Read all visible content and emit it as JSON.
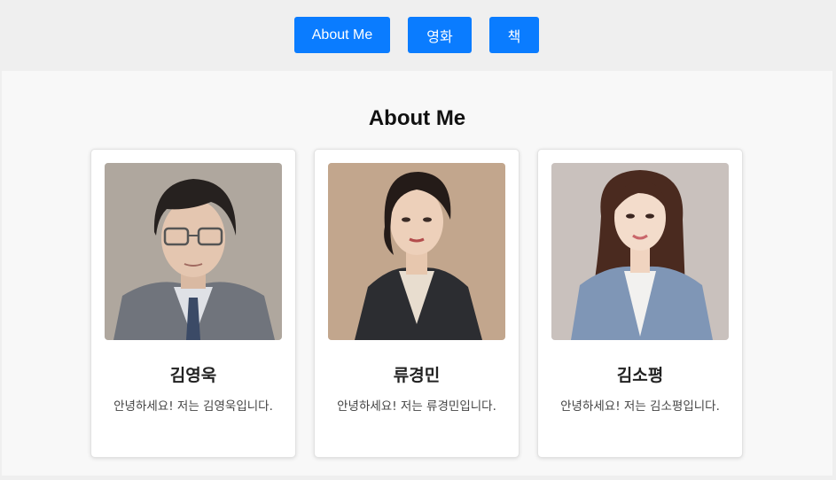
{
  "nav": {
    "about_label": "About Me",
    "movies_label": "영화",
    "books_label": "책",
    "accent_color": "#0a7cff"
  },
  "section": {
    "title": "About Me"
  },
  "profiles": [
    {
      "name": "김영욱",
      "description": "안녕하세요! 저는 김영욱입니다."
    },
    {
      "name": "류경민",
      "description": "안녕하세요! 저는 류경민입니다."
    },
    {
      "name": "김소평",
      "description": "안녕하세요! 저는 김소평입니다."
    }
  ]
}
